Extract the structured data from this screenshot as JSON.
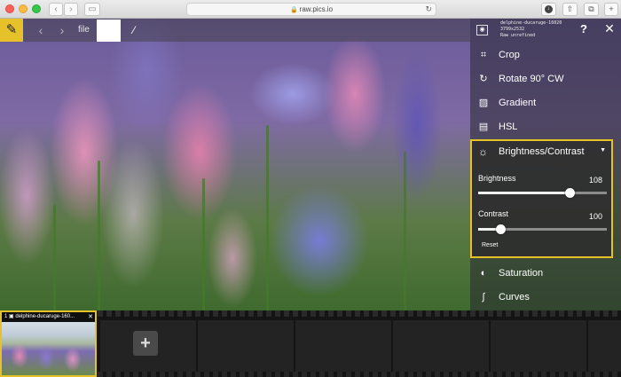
{
  "browser": {
    "url": "raw.pics.io",
    "nav_back": "‹",
    "nav_forward": "›"
  },
  "toolbar": {
    "file_label": "file"
  },
  "panel": {
    "meta_lines": [
      "delphine-ducaruge-16020",
      "3799x2532",
      "Raw unrefined"
    ],
    "help": "?",
    "close": "✕",
    "menu": [
      {
        "label": "Crop",
        "icon": "crop-icon"
      },
      {
        "label": "Rotate 90° CW",
        "icon": "rotate-icon"
      },
      {
        "label": "Gradient",
        "icon": "gradient-icon"
      },
      {
        "label": "HSL",
        "icon": "hsl-icon"
      }
    ],
    "brightness_contrast": {
      "title": "Brightness/Contrast",
      "brightness_label": "Brightness",
      "brightness_value": "108",
      "brightness_level": 0.71,
      "contrast_label": "Contrast",
      "contrast_value": "100",
      "contrast_level": 0.17,
      "reset_label": "Reset"
    },
    "menu_after": [
      {
        "label": "Saturation",
        "icon": "saturation-icon"
      },
      {
        "label": "Curves",
        "icon": "curves-icon"
      }
    ]
  },
  "filmstrip": {
    "thumb_index": "1",
    "thumb_name": "delphine-ducaruge-160...",
    "thumb_close": "✕",
    "add_label": "+"
  },
  "colors": {
    "accent": "#e6c12a"
  }
}
